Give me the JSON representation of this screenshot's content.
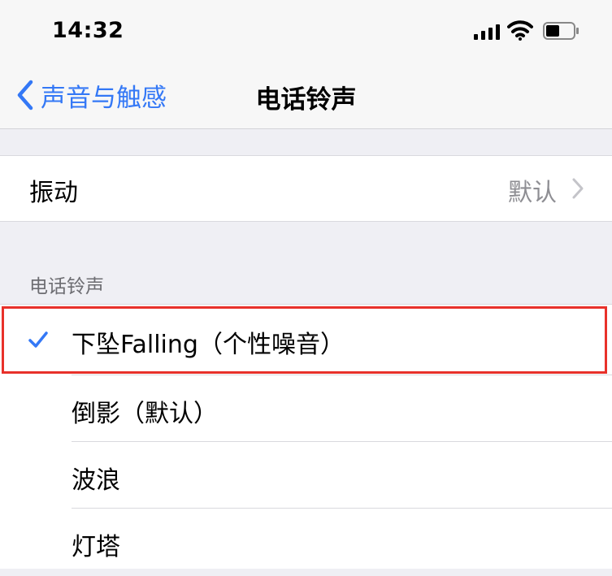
{
  "status": {
    "time": "14:32"
  },
  "nav": {
    "back_label": "声音与触感",
    "title": "电话铃声"
  },
  "vibration": {
    "label": "振动",
    "value": "默认"
  },
  "section": {
    "header": "电话铃声"
  },
  "ringtones": [
    {
      "label": "下坠Falling（个性噪音）",
      "selected": true
    },
    {
      "label": "倒影（默认）",
      "selected": false
    },
    {
      "label": "波浪",
      "selected": false
    },
    {
      "label": "灯塔",
      "selected": false
    }
  ],
  "colors": {
    "accent": "#3478f6",
    "highlight": "#e8312a"
  }
}
